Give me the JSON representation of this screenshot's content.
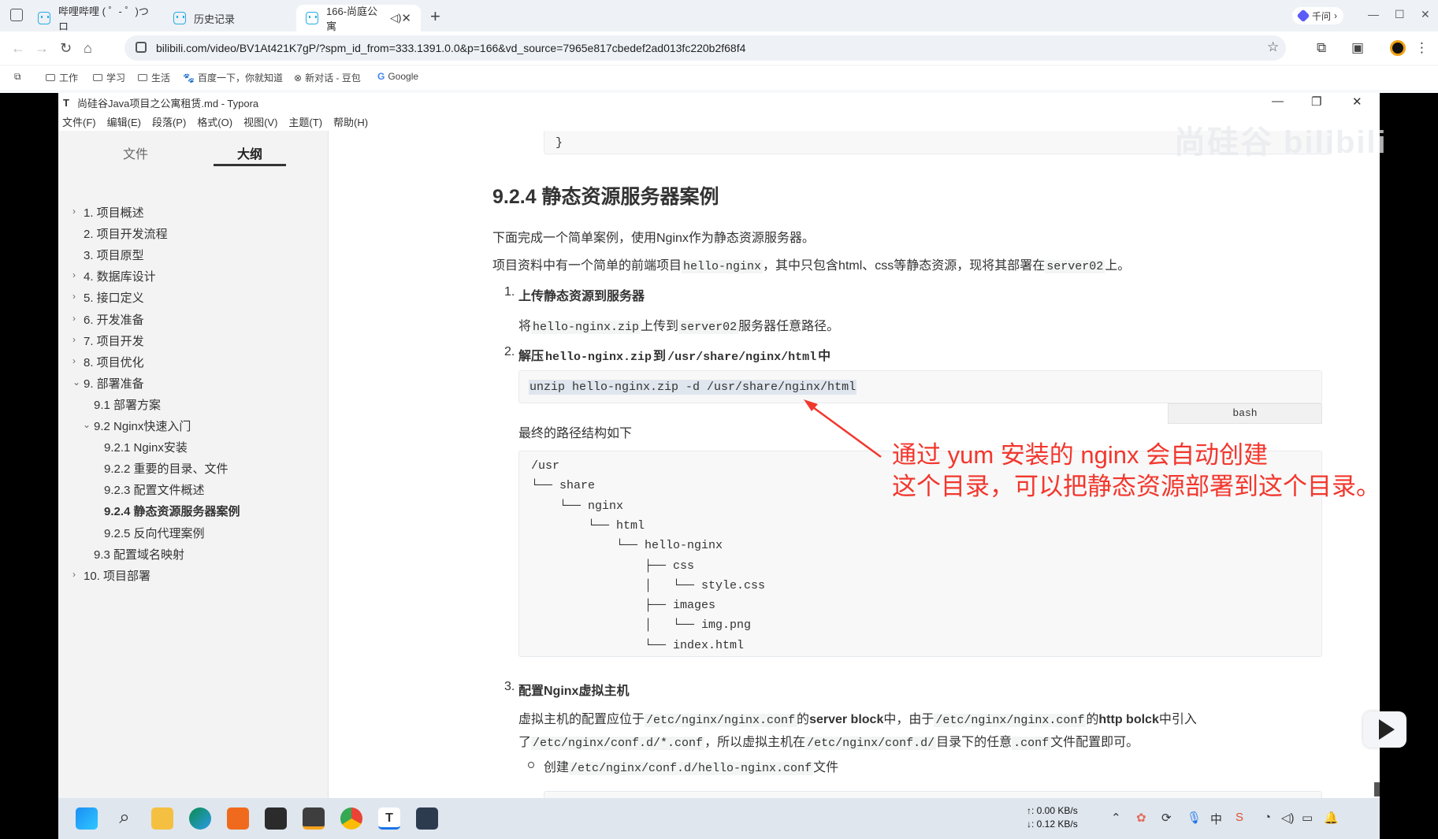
{
  "browser": {
    "tabs": [
      {
        "title": "哔哩哔哩 ( ゜- ゜)つロ",
        "icon": "bilibili-icon",
        "active": false
      },
      {
        "title": "历史记录",
        "icon": "bilibili-icon",
        "active": false
      },
      {
        "title": "166-尚庭公寓",
        "icon": "bilibili-icon",
        "active": true
      }
    ],
    "assistant_label": "千问",
    "url": "bilibili.com/video/BV1At421K7gP/?spm_id_from=333.1391.0.0&p=166&vd_source=7965e817cbedef2ad013fc220b2f68f4",
    "bookmarks": [
      "工作",
      "学习",
      "生活",
      "百度一下，你就知道",
      "新对话 - 豆包",
      "Google"
    ]
  },
  "typora": {
    "title": "尚硅谷Java项目之公寓租赁.md - Typora",
    "menu": [
      "文件(F)",
      "编辑(E)",
      "段落(P)",
      "格式(O)",
      "视图(V)",
      "主题(T)",
      "帮助(H)"
    ],
    "sidebar_tabs": [
      "文件",
      "大纲"
    ],
    "outline": [
      {
        "label": "1. 项目概述",
        "arrow": "›"
      },
      {
        "label": "2. 项目开发流程",
        "arrow": ""
      },
      {
        "label": "3. 项目原型",
        "arrow": ""
      },
      {
        "label": "4. 数据库设计",
        "arrow": "›"
      },
      {
        "label": "5. 接口定义",
        "arrow": "›"
      },
      {
        "label": "6. 开发准备",
        "arrow": "›"
      },
      {
        "label": "7. 项目开发",
        "arrow": "›"
      },
      {
        "label": "8. 项目优化",
        "arrow": "›"
      },
      {
        "label": "9. 部署准备",
        "arrow": "⌄"
      },
      {
        "label": "9.1 部署方案",
        "arrow": ""
      },
      {
        "label": "9.2 Nginx快速入门",
        "arrow": "⌄"
      },
      {
        "label": "9.2.1 Nginx安装",
        "arrow": ""
      },
      {
        "label": "9.2.2 重要的目录、文件",
        "arrow": ""
      },
      {
        "label": "9.2.3 配置文件概述",
        "arrow": ""
      },
      {
        "label": "9.2.4 静态资源服务器案例",
        "arrow": "",
        "current": true
      },
      {
        "label": "9.2.5 反向代理案例",
        "arrow": ""
      },
      {
        "label": "9.3 配置域名映射",
        "arrow": ""
      },
      {
        "label": "10. 项目部署",
        "arrow": "›"
      }
    ]
  },
  "doc": {
    "top_code_tail": "}",
    "heading": "9.2.4 静态资源服务器案例",
    "intro1": "下面完成一个简单案例，使用Nginx作为静态资源服务器。",
    "intro2": {
      "a": "项目资料中有一个简单的前端项目",
      "c1": "hello-nginx",
      "b": "，其中只包含html、css等静态资源，现将其部署在",
      "c2": "server02",
      "d": "上。"
    },
    "step1": {
      "num": "1.",
      "title": "上传静态资源到服务器",
      "a": "将",
      "c1": "hello-nginx.zip",
      "b": "上传到",
      "c2": "server02",
      "d": "服务器任意路径。"
    },
    "step2": {
      "num": "2.",
      "title_a": "解压",
      "c1": "hello-nginx.zip",
      "title_b": "到",
      "c2": "/usr/share/nginx/html",
      "title_c": "中"
    },
    "unzip_cmd": "unzip hello-nginx.zip -d /usr/share/nginx/html",
    "code_lang": "bash",
    "tree_caption": "最终的路径结构如下",
    "tree": [
      "/usr",
      "└── share",
      "    └── nginx",
      "        └── html",
      "            └── hello-nginx",
      "                ├── css",
      "                │   └── style.css",
      "                ├── images",
      "                │   └── img.png",
      "                └── index.html"
    ],
    "step3": {
      "num": "3.",
      "title": "配置Nginx虚拟主机"
    },
    "step3_line1": {
      "a": "虚拟主机的配置应位于",
      "c1": "/etc/nginx/nginx.conf",
      "b": "的",
      "s1": "server block",
      "c": "中，由于",
      "c2": "/etc/nginx/nginx.conf",
      "d": "的",
      "s2": "http bolck",
      "e": "中引入"
    },
    "step3_line2": {
      "a": "了",
      "c1": "/etc/nginx/conf.d/*.conf",
      "b": "，所以虚拟主机在",
      "c2": "/etc/nginx/conf.d/",
      "c": "目录下的任意",
      "c3": ".conf",
      "d": "文件配置即可。"
    },
    "bullet": {
      "a": "创建",
      "c1": "/etc/nginx/conf.d/hello-nginx.conf",
      "b": "文件"
    }
  },
  "annotation": {
    "line1": "通过 yum 安装的 nginx 会自动创建",
    "line2": "这个目录，可以把静态资源部署到这个目录。",
    "color": "#f2372d"
  },
  "watermark": "尚硅谷 bilibili",
  "taskbar": {
    "upload_speed": "↑: 0.00 KB/s",
    "download_speed": "↓: 0.12 KB/s",
    "tray_ime": "中"
  }
}
